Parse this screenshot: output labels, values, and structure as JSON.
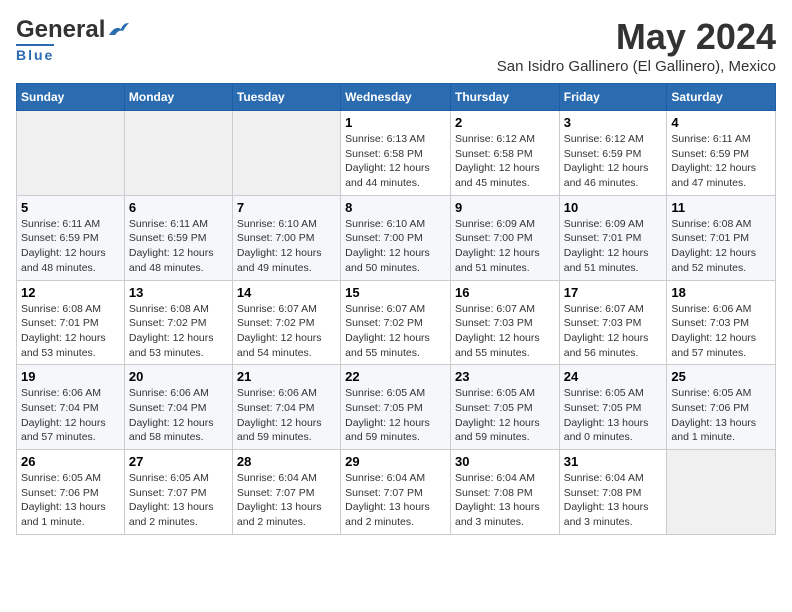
{
  "logo": {
    "general": "General",
    "blue": "Blue",
    "tagline": "Blue"
  },
  "title": "May 2024",
  "subtitle": "San Isidro Gallinero (El Gallinero), Mexico",
  "days_header": [
    "Sunday",
    "Monday",
    "Tuesday",
    "Wednesday",
    "Thursday",
    "Friday",
    "Saturday"
  ],
  "weeks": [
    [
      {
        "day": "",
        "info": ""
      },
      {
        "day": "",
        "info": ""
      },
      {
        "day": "",
        "info": ""
      },
      {
        "day": "1",
        "info": "Sunrise: 6:13 AM\nSunset: 6:58 PM\nDaylight: 12 hours\nand 44 minutes."
      },
      {
        "day": "2",
        "info": "Sunrise: 6:12 AM\nSunset: 6:58 PM\nDaylight: 12 hours\nand 45 minutes."
      },
      {
        "day": "3",
        "info": "Sunrise: 6:12 AM\nSunset: 6:59 PM\nDaylight: 12 hours\nand 46 minutes."
      },
      {
        "day": "4",
        "info": "Sunrise: 6:11 AM\nSunset: 6:59 PM\nDaylight: 12 hours\nand 47 minutes."
      }
    ],
    [
      {
        "day": "5",
        "info": "Sunrise: 6:11 AM\nSunset: 6:59 PM\nDaylight: 12 hours\nand 48 minutes."
      },
      {
        "day": "6",
        "info": "Sunrise: 6:11 AM\nSunset: 6:59 PM\nDaylight: 12 hours\nand 48 minutes."
      },
      {
        "day": "7",
        "info": "Sunrise: 6:10 AM\nSunset: 7:00 PM\nDaylight: 12 hours\nand 49 minutes."
      },
      {
        "day": "8",
        "info": "Sunrise: 6:10 AM\nSunset: 7:00 PM\nDaylight: 12 hours\nand 50 minutes."
      },
      {
        "day": "9",
        "info": "Sunrise: 6:09 AM\nSunset: 7:00 PM\nDaylight: 12 hours\nand 51 minutes."
      },
      {
        "day": "10",
        "info": "Sunrise: 6:09 AM\nSunset: 7:01 PM\nDaylight: 12 hours\nand 51 minutes."
      },
      {
        "day": "11",
        "info": "Sunrise: 6:08 AM\nSunset: 7:01 PM\nDaylight: 12 hours\nand 52 minutes."
      }
    ],
    [
      {
        "day": "12",
        "info": "Sunrise: 6:08 AM\nSunset: 7:01 PM\nDaylight: 12 hours\nand 53 minutes."
      },
      {
        "day": "13",
        "info": "Sunrise: 6:08 AM\nSunset: 7:02 PM\nDaylight: 12 hours\nand 53 minutes."
      },
      {
        "day": "14",
        "info": "Sunrise: 6:07 AM\nSunset: 7:02 PM\nDaylight: 12 hours\nand 54 minutes."
      },
      {
        "day": "15",
        "info": "Sunrise: 6:07 AM\nSunset: 7:02 PM\nDaylight: 12 hours\nand 55 minutes."
      },
      {
        "day": "16",
        "info": "Sunrise: 6:07 AM\nSunset: 7:03 PM\nDaylight: 12 hours\nand 55 minutes."
      },
      {
        "day": "17",
        "info": "Sunrise: 6:07 AM\nSunset: 7:03 PM\nDaylight: 12 hours\nand 56 minutes."
      },
      {
        "day": "18",
        "info": "Sunrise: 6:06 AM\nSunset: 7:03 PM\nDaylight: 12 hours\nand 57 minutes."
      }
    ],
    [
      {
        "day": "19",
        "info": "Sunrise: 6:06 AM\nSunset: 7:04 PM\nDaylight: 12 hours\nand 57 minutes."
      },
      {
        "day": "20",
        "info": "Sunrise: 6:06 AM\nSunset: 7:04 PM\nDaylight: 12 hours\nand 58 minutes."
      },
      {
        "day": "21",
        "info": "Sunrise: 6:06 AM\nSunset: 7:04 PM\nDaylight: 12 hours\nand 59 minutes."
      },
      {
        "day": "22",
        "info": "Sunrise: 6:05 AM\nSunset: 7:05 PM\nDaylight: 12 hours\nand 59 minutes."
      },
      {
        "day": "23",
        "info": "Sunrise: 6:05 AM\nSunset: 7:05 PM\nDaylight: 12 hours\nand 59 minutes."
      },
      {
        "day": "24",
        "info": "Sunrise: 6:05 AM\nSunset: 7:05 PM\nDaylight: 13 hours\nand 0 minutes."
      },
      {
        "day": "25",
        "info": "Sunrise: 6:05 AM\nSunset: 7:06 PM\nDaylight: 13 hours\nand 1 minute."
      }
    ],
    [
      {
        "day": "26",
        "info": "Sunrise: 6:05 AM\nSunset: 7:06 PM\nDaylight: 13 hours\nand 1 minute."
      },
      {
        "day": "27",
        "info": "Sunrise: 6:05 AM\nSunset: 7:07 PM\nDaylight: 13 hours\nand 2 minutes."
      },
      {
        "day": "28",
        "info": "Sunrise: 6:04 AM\nSunset: 7:07 PM\nDaylight: 13 hours\nand 2 minutes."
      },
      {
        "day": "29",
        "info": "Sunrise: 6:04 AM\nSunset: 7:07 PM\nDaylight: 13 hours\nand 2 minutes."
      },
      {
        "day": "30",
        "info": "Sunrise: 6:04 AM\nSunset: 7:08 PM\nDaylight: 13 hours\nand 3 minutes."
      },
      {
        "day": "31",
        "info": "Sunrise: 6:04 AM\nSunset: 7:08 PM\nDaylight: 13 hours\nand 3 minutes."
      },
      {
        "day": "",
        "info": ""
      }
    ]
  ]
}
